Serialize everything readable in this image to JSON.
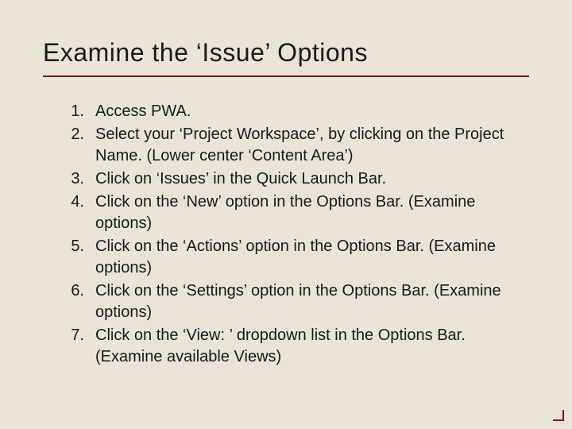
{
  "title": "Examine the ‘Issue’ Options",
  "items": [
    {
      "num": "1.",
      "text": "Access PWA."
    },
    {
      "num": "2.",
      "text": "Select your ‘Project Workspace’, by clicking on the Project Name.  (Lower center ‘Content Area’)"
    },
    {
      "num": "3.",
      "text": "Click on ‘Issues’ in the Quick Launch Bar."
    },
    {
      "num": "4.",
      "text": "Click on the ‘New’ option in the Options Bar.  (Examine options)"
    },
    {
      "num": "5.",
      "text": "Click on the ‘Actions’ option in the Options Bar.  (Examine options)"
    },
    {
      "num": "6.",
      "text": "Click on the ‘Settings’ option in the Options Bar.  (Examine options)"
    },
    {
      "num": "7.",
      "text": "Click on the ‘View: ’ dropdown list in the Options Bar.  (Examine available Views)"
    }
  ]
}
